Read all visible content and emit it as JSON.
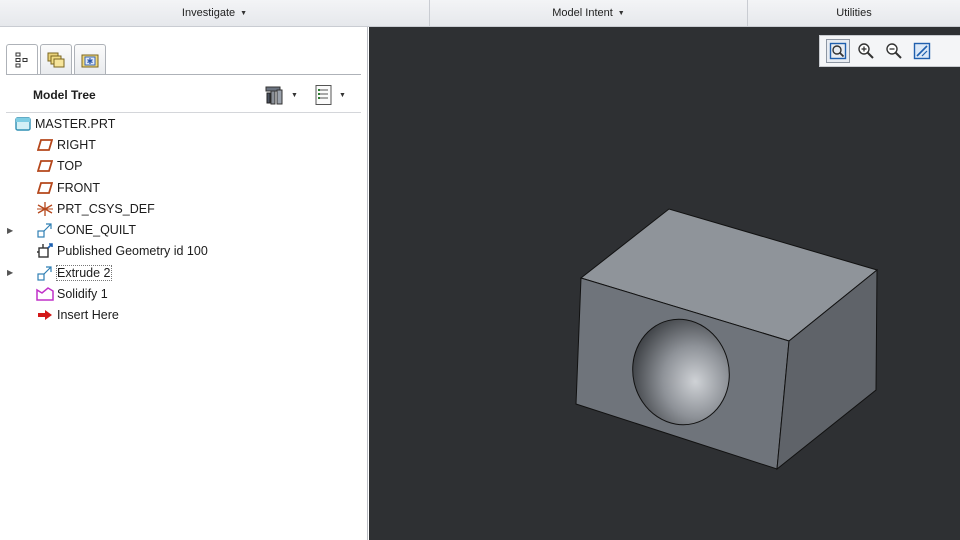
{
  "ribbon": {
    "groups": [
      {
        "label": "Investigate",
        "has_dropdown": true
      },
      {
        "label": "Model Intent",
        "has_dropdown": true
      },
      {
        "label": "Utilities",
        "has_dropdown": false
      }
    ]
  },
  "navigator": {
    "tabs": [
      "model-tree-tab-icon",
      "folder-browser-tab-icon",
      "favorites-tab-icon"
    ],
    "active_tab": 0,
    "title": "Model Tree",
    "settings_icon": "tree-settings-icon",
    "columns_icon": "tree-columns-icon"
  },
  "model_tree": {
    "root": "MASTER.PRT",
    "items": [
      {
        "label": "RIGHT",
        "icon": "datum-plane-icon",
        "expandable": false
      },
      {
        "label": "TOP",
        "icon": "datum-plane-icon",
        "expandable": false
      },
      {
        "label": "FRONT",
        "icon": "datum-plane-icon",
        "expandable": false
      },
      {
        "label": "PRT_CSYS_DEF",
        "icon": "coordinate-system-icon",
        "expandable": false
      },
      {
        "label": "CONE_QUILT",
        "icon": "quilt-feature-icon",
        "expandable": true
      },
      {
        "label": "Published Geometry id 100",
        "icon": "published-geometry-icon",
        "expandable": false
      },
      {
        "label": "Extrude 2",
        "icon": "quilt-feature-icon",
        "expandable": true
      },
      {
        "label": "Solidify 1",
        "icon": "solidify-icon",
        "expandable": false
      },
      {
        "label": "Insert Here",
        "icon": "insert-arrow-icon",
        "expandable": false
      }
    ]
  },
  "view_toolbar": {
    "buttons": [
      "refit-icon",
      "zoom-in-icon",
      "zoom-out-icon",
      "repaint-icon"
    ]
  },
  "colors": {
    "viewport_background": "#2e3033",
    "part_top": "#8f949a",
    "part_front": "#6f747b",
    "part_side": "#5f6369",
    "plane_icon": "#b5471b",
    "solidify_icon": "#c030c8",
    "insert_arrow": "#d31818"
  }
}
